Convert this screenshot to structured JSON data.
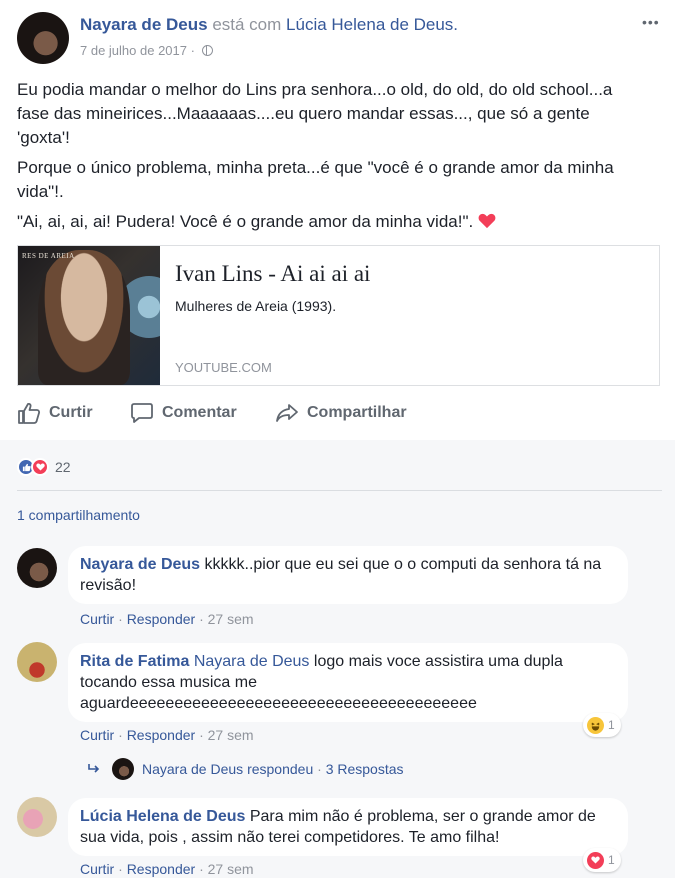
{
  "post": {
    "author": "Nayara de Deus",
    "with_text": "está com",
    "with_person": "Lúcia Helena de Deus.",
    "date": "7 de julho de 2017 ·",
    "more_icon": "more-icon",
    "text_p1": "Eu podia mandar o melhor do Lins pra senhora...o old, do old, do old school...a fase das mineirices...Maaaaaas....eu quero mandar essas..., que só a gente 'goxta'!",
    "text_p2": "Porque o único problema, minha preta...é que \"você é o grande amor da minha vida\"!.",
    "text_p3": "\"Ai, ai, ai, ai! Pudera! Você é o grande amor da minha vida!\".",
    "link": {
      "title": "Ivan Lins - Ai ai ai ai",
      "description": "Mulheres de Areia (1993).",
      "domain": "YOUTUBE.COM",
      "thumb_text": "RES DE AREIA"
    },
    "actions": {
      "like": "Curtir",
      "comment": "Comentar",
      "share": "Compartilhar"
    },
    "reactions_count": "22",
    "shares": "1 compartilhamento"
  },
  "comments": [
    {
      "author": "Nayara de Deus",
      "text": "kkkkk..pior que eu sei que o o computi da senhora tá na revisão!",
      "like": "Curtir",
      "reply": "Responder",
      "time": "27 sem"
    },
    {
      "author": "Rita de Fatima",
      "tag": "Nayara de Deus",
      "text": "logo mais voce assistira uma dupla tocando essa musica me aguardeeeeeeeeeeeeeeeeeeeeeeeeeeeeeeeeeeeeeee",
      "like": "Curtir",
      "reply": "Responder",
      "time": "27 sem",
      "reaction_count": "1"
    },
    {
      "author": "Lúcia Helena de Deus",
      "text": "Para mim não é problema, ser o grande amor de sua vida, pois , assim não terei competidores. Te amo filha!",
      "like": "Curtir",
      "reply": "Responder",
      "time": "27 sem",
      "reaction_count": "1"
    }
  ],
  "reply_summary": {
    "name": "Nayara de Deus",
    "text": "respondeu",
    "count": "3 Respostas"
  },
  "colors": {
    "link_blue": "#365899",
    "meta_gray": "#90949c",
    "like_blue": "#4267b2",
    "love_red": "#f33e58",
    "comments_bg": "#f6f7f9"
  }
}
